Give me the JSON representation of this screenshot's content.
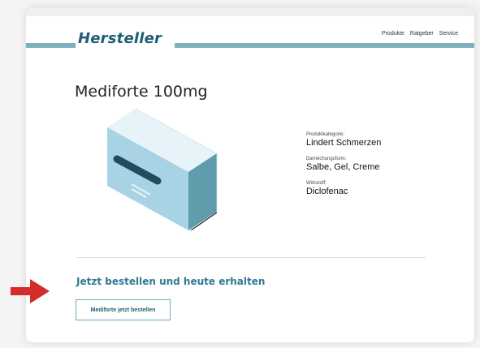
{
  "header": {
    "logo": "Hersteller",
    "nav": [
      "Produkte",
      "Ratgeber",
      "Service"
    ]
  },
  "product": {
    "title": "Mediforte 100mg",
    "details": [
      {
        "label": "Produktkategorie:",
        "value": "Lindert Schmerzen"
      },
      {
        "label": "Darreichungsform:",
        "value": "Salbe, Gel, Creme"
      },
      {
        "label": "Wirkstoff:",
        "value": "Diclofenac"
      }
    ]
  },
  "cta": {
    "heading": "Jetzt bestellen und heute erhalten",
    "button_label": "Mediforte jetzt bestellen"
  },
  "colors": {
    "brand": "#1e5e75",
    "accent_band": "#7fb1bf",
    "arrow": "#d62b2b"
  }
}
